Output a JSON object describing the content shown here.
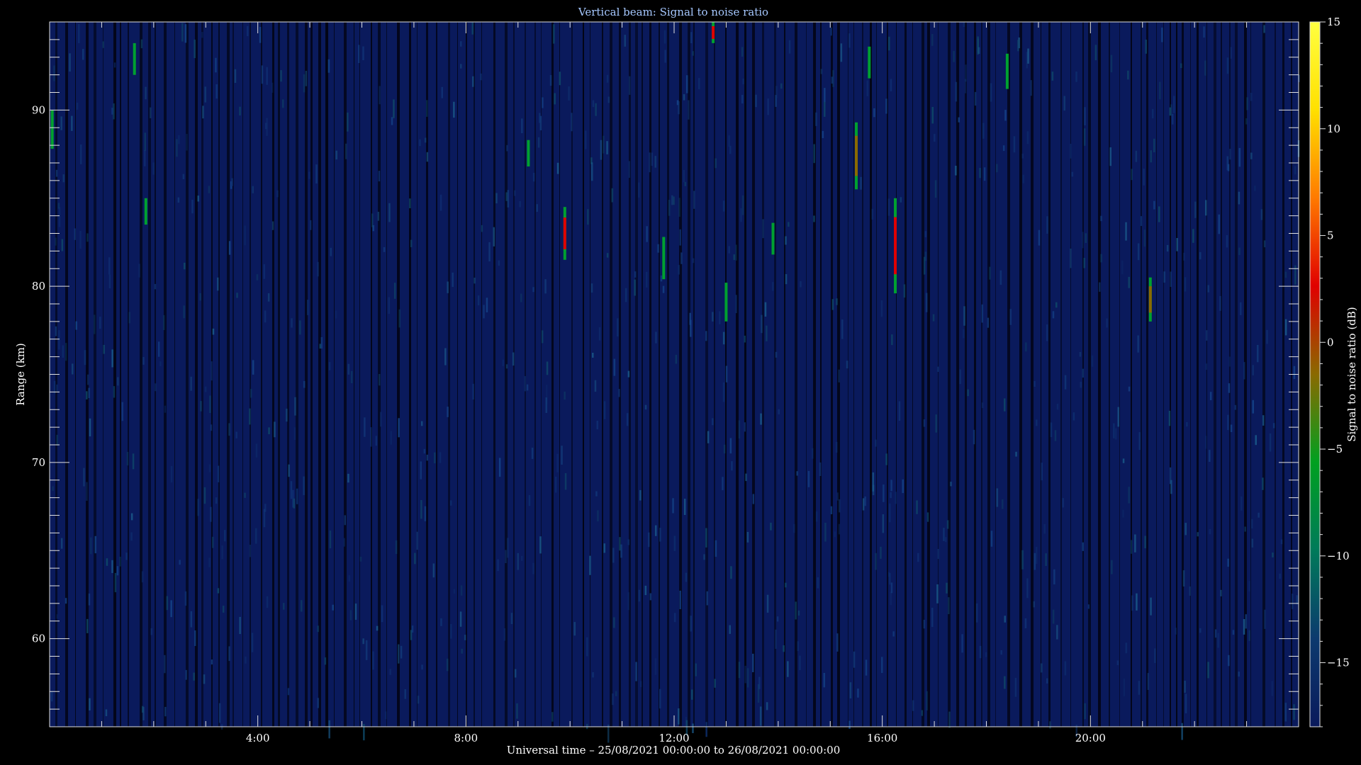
{
  "chart_data": {
    "type": "heatmap",
    "title": "Vertical beam: Signal to noise ratio",
    "xlabel": "Universal time – 25/08/2021 00:00:00 to 26/08/2021 00:00:00",
    "ylabel": "Range (km)",
    "colorbar_label": "Signal to noise ratio (dB)",
    "x_range_hours": [
      0,
      24
    ],
    "y_range_km": [
      55,
      95
    ],
    "x_ticks": [
      {
        "value": 4,
        "label": "4:00"
      },
      {
        "value": 8,
        "label": "8:00"
      },
      {
        "value": 12,
        "label": "12:00"
      },
      {
        "value": 16,
        "label": "16:00"
      },
      {
        "value": 20,
        "label": "20:00"
      }
    ],
    "y_ticks": [
      {
        "value": 60,
        "label": "60"
      },
      {
        "value": 70,
        "label": "70"
      },
      {
        "value": 80,
        "label": "80"
      },
      {
        "value": 90,
        "label": "90"
      }
    ],
    "colorbar_range_db": [
      -18,
      15
    ],
    "colorbar_ticks": [
      {
        "value": 15,
        "label": "15"
      },
      {
        "value": 10,
        "label": "10"
      },
      {
        "value": 5,
        "label": "5"
      },
      {
        "value": 0,
        "label": "0"
      },
      {
        "value": -5,
        "label": "−5"
      },
      {
        "value": -10,
        "label": "−10"
      },
      {
        "value": -15,
        "label": "−15"
      }
    ],
    "colormap": [
      "#0a1a5c",
      "#0c3a6e",
      "#007a5a",
      "#00a020",
      "#8a6a00",
      "#e00000",
      "#ff7a00",
      "#ffe000",
      "#ffff40"
    ],
    "background_color": "#0a1a5c",
    "echoes": [
      {
        "time_h": 0.05,
        "range_from": 87.8,
        "range_to": 90.0,
        "snr_db": -5
      },
      {
        "time_h": 1.63,
        "range_from": 92.0,
        "range_to": 93.8,
        "snr_db": -7
      },
      {
        "time_h": 1.85,
        "range_from": 83.5,
        "range_to": 85.0,
        "snr_db": -6
      },
      {
        "time_h": 9.2,
        "range_from": 86.8,
        "range_to": 88.3,
        "snr_db": -6
      },
      {
        "time_h": 9.9,
        "range_from": 81.5,
        "range_to": 84.5,
        "snr_db": 2
      },
      {
        "time_h": 11.8,
        "range_from": 80.4,
        "range_to": 82.8,
        "snr_db": -5
      },
      {
        "time_h": 12.75,
        "range_from": 93.8,
        "range_to": 95.0,
        "snr_db": 3
      },
      {
        "time_h": 13.0,
        "range_from": 78.0,
        "range_to": 80.2,
        "snr_db": -5
      },
      {
        "time_h": 13.9,
        "range_from": 81.8,
        "range_to": 83.6,
        "snr_db": -6
      },
      {
        "time_h": 15.5,
        "range_from": 85.5,
        "range_to": 89.3,
        "snr_db": 0
      },
      {
        "time_h": 15.75,
        "range_from": 91.8,
        "range_to": 93.6,
        "snr_db": -6
      },
      {
        "time_h": 16.25,
        "range_from": 79.6,
        "range_to": 85.0,
        "snr_db": 3
      },
      {
        "time_h": 18.4,
        "range_from": 91.2,
        "range_to": 93.2,
        "snr_db": -6
      },
      {
        "time_h": 21.15,
        "range_from": 78.0,
        "range_to": 80.5,
        "snr_db": 0
      }
    ]
  }
}
